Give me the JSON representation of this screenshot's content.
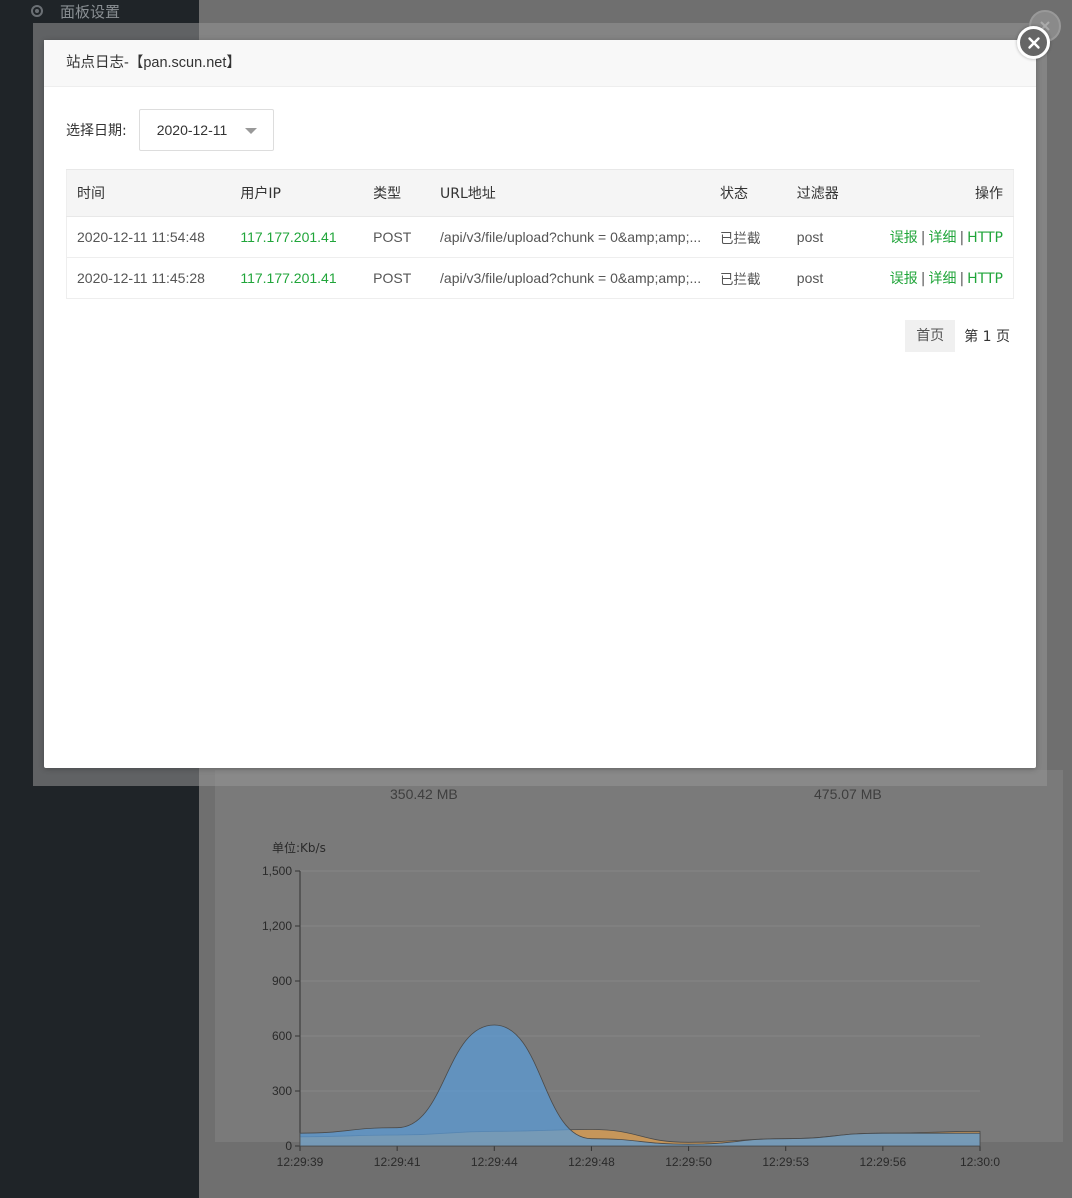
{
  "sidebar": {
    "item_label": "面板设置",
    "item_icon": "gear-icon"
  },
  "background": {
    "stats": [
      "350.42 MB",
      "475.07 MB"
    ]
  },
  "chart_data": {
    "type": "area",
    "ylabel": "单位:Kb/s",
    "ylim": [
      0,
      1500
    ],
    "yticks": [
      "0",
      "300",
      "600",
      "900",
      "1,200",
      "1,500"
    ],
    "x": [
      "12:29:39",
      "12:29:41",
      "12:29:44",
      "12:29:48",
      "12:29:50",
      "12:29:53",
      "12:29:56",
      "12:30:0"
    ],
    "series": [
      {
        "color": "#e0a050",
        "values": [
          50,
          60,
          80,
          90,
          20,
          40,
          70,
          80
        ]
      },
      {
        "color": "#5b9bd5",
        "values": [
          70,
          100,
          660,
          40,
          10,
          40,
          70,
          70
        ]
      }
    ]
  },
  "modal": {
    "title": "站点日志-【pan.scun.net】",
    "date_label": "选择日期:",
    "date_value": "2020-12-11",
    "columns": [
      "时间",
      "用户IP",
      "类型",
      "URL地址",
      "状态",
      "过滤器",
      "操作"
    ],
    "rows": [
      {
        "time": "2020-12-11 11:54:48",
        "ip": "117.177.201.41",
        "type": "POST",
        "url": "/api/v3/file/upload?chunk = 0&amp;amp;...",
        "status": "已拦截",
        "filter": "post"
      },
      {
        "time": "2020-12-11 11:45:28",
        "ip": "117.177.201.41",
        "type": "POST",
        "url": "/api/v3/file/upload?chunk = 0&amp;amp;...",
        "status": "已拦截",
        "filter": "post"
      }
    ],
    "actions": {
      "report": "误报",
      "detail": "详细",
      "http": "HTTP",
      "separator": "|"
    },
    "pager": {
      "first": "首页",
      "current": "第 1 页"
    }
  }
}
